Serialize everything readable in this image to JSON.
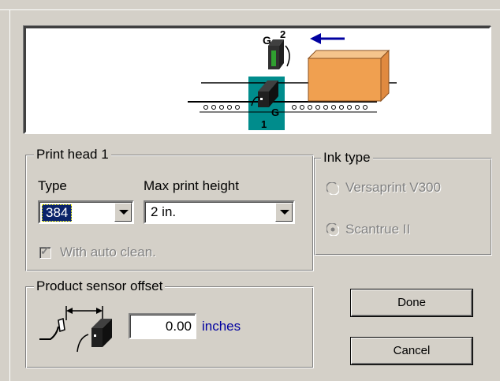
{
  "preview": {
    "head_2_label": "G",
    "head_2_number": "2",
    "head_1_label": "G",
    "head_1_number": "1",
    "colors": {
      "conveyor": "#000000",
      "highlight": "#008c8c",
      "box": "#f0a050",
      "arrow": "#0000a0"
    }
  },
  "print_head": {
    "title": "Print head 1",
    "type_label": "Type",
    "type_value": "384",
    "max_height_label": "Max print height",
    "max_height_value": "2 in.",
    "auto_clean_label": "With auto clean.",
    "auto_clean_checked": true
  },
  "sensor": {
    "title": "Product sensor offset",
    "offset_value": "0.00",
    "unit_label": "inches"
  },
  "ink_type": {
    "title": "Ink type",
    "options": [
      {
        "label": "Versaprint V300",
        "selected": false
      },
      {
        "label": "Scantrue II",
        "selected": true
      }
    ]
  },
  "buttons": {
    "done": "Done",
    "cancel": "Cancel"
  },
  "icons": {
    "sensor": "sensor-icon",
    "print_head": "print-head-icon",
    "direction_arrow": "arrow-left-icon"
  }
}
